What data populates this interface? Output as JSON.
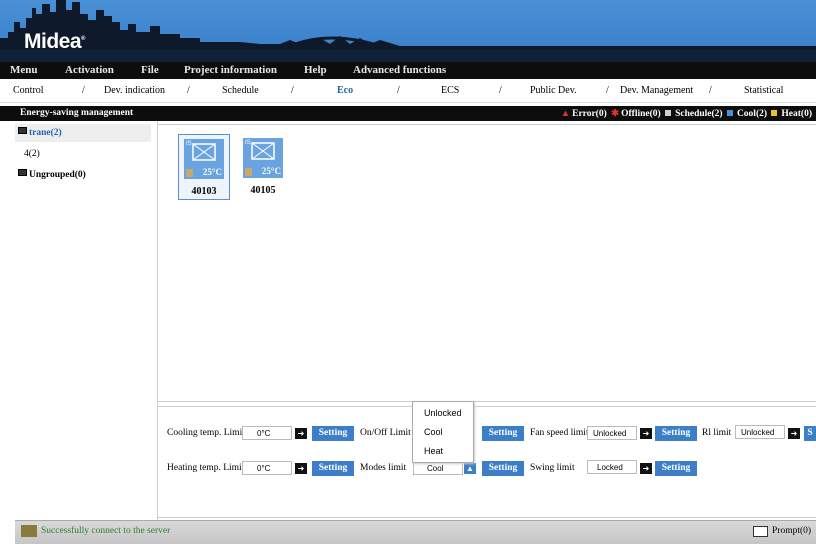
{
  "brand": {
    "logo_text": "Midea",
    "trademark": "®"
  },
  "menu": [
    {
      "label": "Menu"
    },
    {
      "label": "Activation"
    },
    {
      "label": "File"
    },
    {
      "label": "Project information"
    },
    {
      "label": "Help"
    },
    {
      "label": "Advanced functions"
    }
  ],
  "tabs": [
    {
      "label": "Control"
    },
    {
      "label": "Dev. indication"
    },
    {
      "label": "Schedule"
    },
    {
      "label": "Eco",
      "active": true
    },
    {
      "label": "ECS"
    },
    {
      "label": "Public Dev."
    },
    {
      "label": "Dev. Management"
    },
    {
      "label": "Statistical"
    }
  ],
  "tab_separator": "/",
  "section": {
    "title": "Energy-saving management"
  },
  "legend": {
    "error": "Error(0)",
    "offline": "Offline(0)",
    "schedule": "Schedule(2)",
    "cool": "Cool(2)",
    "heat": "Heat(0)",
    "colors": {
      "error": "#e0312b",
      "offline": "#e0312b",
      "schedule": "#cfcfcf",
      "cool": "#4a90d6",
      "heat": "#f0c02a"
    }
  },
  "tree": [
    {
      "label": "trane(2)",
      "selected": true
    },
    {
      "label": "4(2)"
    },
    {
      "label": "Ungrouped(0)"
    }
  ],
  "devices": [
    {
      "id": "40103",
      "temp": "25°C",
      "tag": "IS",
      "selected": true,
      "icon": "cassette-ac-icon"
    },
    {
      "id": "40105",
      "temp": "25°C",
      "tag": "IS",
      "selected": false,
      "icon": "cassette-ac-icon"
    }
  ],
  "controls": {
    "cooling_temp_label": "Cooling temp. Limit",
    "cooling_temp_value": "0°C",
    "heating_temp_label": "Heating temp. Limit",
    "heating_temp_value": "0°C",
    "onoff_label": "On/Off Limit",
    "modes_label": "Modes limit",
    "modes_value": "Cool",
    "fan_label": "Fan speed limit",
    "fan_value": "Unlocked",
    "swing_label": "Swing limit",
    "swing_value": "Locked",
    "rl_label": "Rl limit",
    "rl_value": "Unlocked",
    "setting_label": "Setting",
    "cut_button_label": "S"
  },
  "dropdown": {
    "options": [
      "Unlocked",
      "Cool",
      "Heat"
    ]
  },
  "status": {
    "message": "Successfully connect to the server",
    "prompt": "Prompt(0)"
  }
}
